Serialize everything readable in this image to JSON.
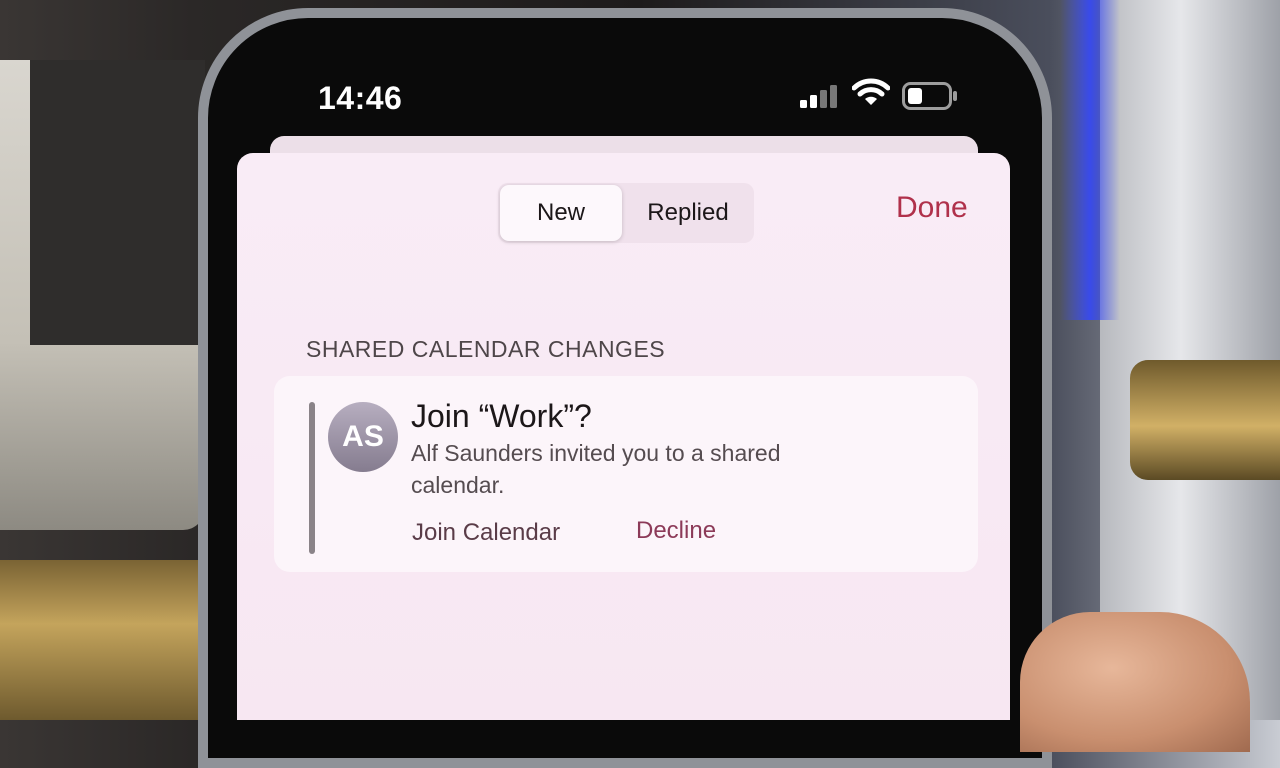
{
  "status_bar": {
    "time": "14:46",
    "icons": [
      "signal-icon",
      "wifi-icon",
      "battery-icon"
    ]
  },
  "header": {
    "tabs": [
      {
        "label": "New",
        "selected": true
      },
      {
        "label": "Replied",
        "selected": false
      }
    ],
    "done_label": "Done"
  },
  "section": {
    "title": "SHARED CALENDAR CHANGES"
  },
  "invitation": {
    "avatar_initials": "AS",
    "title": "Join “Work”?",
    "body": "Alf Saunders invited you to a shared calendar.",
    "join_label": "Join Calendar",
    "decline_label": "Decline"
  },
  "colors": {
    "accent": "#b0314b",
    "sheet_background": "#f9ecf6",
    "card_background": "#fcf5fa"
  }
}
